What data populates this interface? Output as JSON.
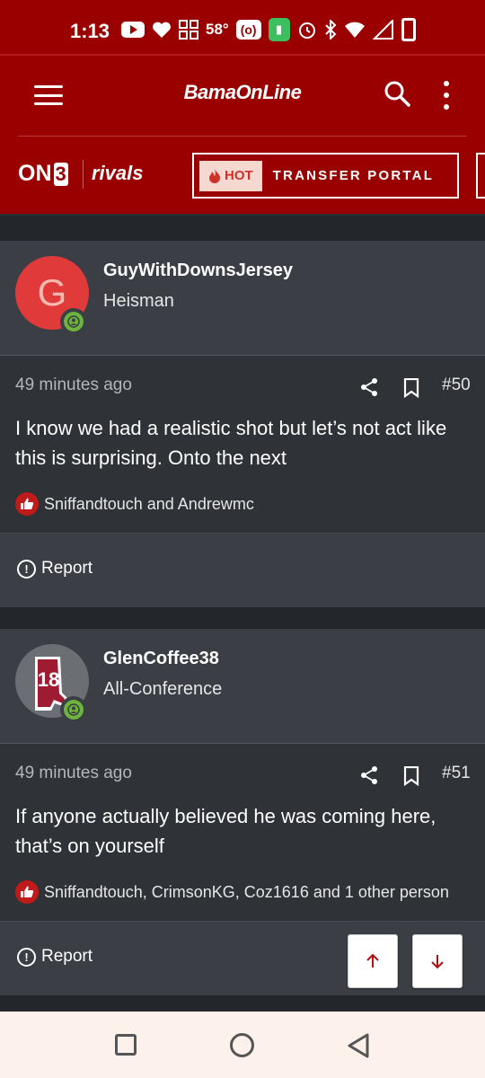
{
  "status_bar": {
    "time": "1:13",
    "temperature": "58°",
    "icons": [
      "youtube-icon",
      "heart-icon",
      "apps-icon",
      "radio-icon",
      "battery-saver-icon",
      "alarm-icon",
      "bluetooth-icon",
      "wifi-icon",
      "signal-icon",
      "battery-icon"
    ]
  },
  "header": {
    "logo": "BamaOnLine",
    "on3_prefix": "ON",
    "on3_suffix": "3",
    "rivals": "rivals",
    "hot_badge": "HOT",
    "portal_label": "TRANSFER PORTAL",
    "brand_color": "#9a0000"
  },
  "posts": [
    {
      "avatar_letter": "G",
      "username": "GuyWithDownsJersey",
      "user_title": "Heisman",
      "time": "49 minutes ago",
      "post_number": "#50",
      "body": "I know we had a realistic shot but let’s not act like this is surprising. Onto the next",
      "reactions": "Sniffandtouch and Andrewmc",
      "report_label": "Report"
    },
    {
      "avatar_number": "18",
      "username": "GlenCoffee38",
      "user_title": "All-Conference",
      "time": "49 minutes ago",
      "post_number": "#51",
      "body": "If anyone actually believed he was coming here, that’s on yourself",
      "reactions": "Sniffandtouch, CrimsonKG, Coz1616 and 1 other person",
      "report_label": "Report"
    }
  ],
  "scroll_buttons": [
    "scroll-up-icon",
    "scroll-down-icon"
  ],
  "nav_bar": [
    "recents-icon",
    "home-icon",
    "back-icon"
  ]
}
